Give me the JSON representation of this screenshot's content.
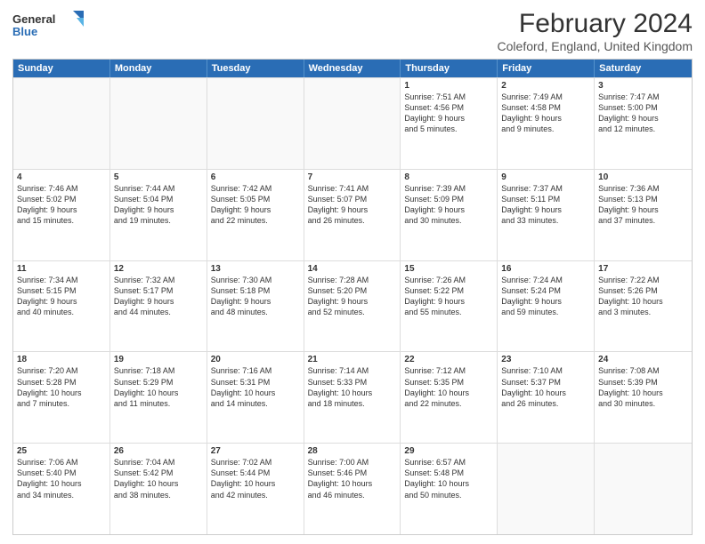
{
  "header": {
    "logo_general": "General",
    "logo_blue": "Blue",
    "title": "February 2024",
    "location": "Coleford, England, United Kingdom"
  },
  "days_of_week": [
    "Sunday",
    "Monday",
    "Tuesday",
    "Wednesday",
    "Thursday",
    "Friday",
    "Saturday"
  ],
  "weeks": [
    [
      {
        "day": "",
        "text": "",
        "empty": true
      },
      {
        "day": "",
        "text": "",
        "empty": true
      },
      {
        "day": "",
        "text": "",
        "empty": true
      },
      {
        "day": "",
        "text": "",
        "empty": true
      },
      {
        "day": "1",
        "text": "Sunrise: 7:51 AM\nSunset: 4:56 PM\nDaylight: 9 hours\nand 5 minutes.",
        "empty": false
      },
      {
        "day": "2",
        "text": "Sunrise: 7:49 AM\nSunset: 4:58 PM\nDaylight: 9 hours\nand 9 minutes.",
        "empty": false
      },
      {
        "day": "3",
        "text": "Sunrise: 7:47 AM\nSunset: 5:00 PM\nDaylight: 9 hours\nand 12 minutes.",
        "empty": false
      }
    ],
    [
      {
        "day": "4",
        "text": "Sunrise: 7:46 AM\nSunset: 5:02 PM\nDaylight: 9 hours\nand 15 minutes.",
        "empty": false
      },
      {
        "day": "5",
        "text": "Sunrise: 7:44 AM\nSunset: 5:04 PM\nDaylight: 9 hours\nand 19 minutes.",
        "empty": false
      },
      {
        "day": "6",
        "text": "Sunrise: 7:42 AM\nSunset: 5:05 PM\nDaylight: 9 hours\nand 22 minutes.",
        "empty": false
      },
      {
        "day": "7",
        "text": "Sunrise: 7:41 AM\nSunset: 5:07 PM\nDaylight: 9 hours\nand 26 minutes.",
        "empty": false
      },
      {
        "day": "8",
        "text": "Sunrise: 7:39 AM\nSunset: 5:09 PM\nDaylight: 9 hours\nand 30 minutes.",
        "empty": false
      },
      {
        "day": "9",
        "text": "Sunrise: 7:37 AM\nSunset: 5:11 PM\nDaylight: 9 hours\nand 33 minutes.",
        "empty": false
      },
      {
        "day": "10",
        "text": "Sunrise: 7:36 AM\nSunset: 5:13 PM\nDaylight: 9 hours\nand 37 minutes.",
        "empty": false
      }
    ],
    [
      {
        "day": "11",
        "text": "Sunrise: 7:34 AM\nSunset: 5:15 PM\nDaylight: 9 hours\nand 40 minutes.",
        "empty": false
      },
      {
        "day": "12",
        "text": "Sunrise: 7:32 AM\nSunset: 5:17 PM\nDaylight: 9 hours\nand 44 minutes.",
        "empty": false
      },
      {
        "day": "13",
        "text": "Sunrise: 7:30 AM\nSunset: 5:18 PM\nDaylight: 9 hours\nand 48 minutes.",
        "empty": false
      },
      {
        "day": "14",
        "text": "Sunrise: 7:28 AM\nSunset: 5:20 PM\nDaylight: 9 hours\nand 52 minutes.",
        "empty": false
      },
      {
        "day": "15",
        "text": "Sunrise: 7:26 AM\nSunset: 5:22 PM\nDaylight: 9 hours\nand 55 minutes.",
        "empty": false
      },
      {
        "day": "16",
        "text": "Sunrise: 7:24 AM\nSunset: 5:24 PM\nDaylight: 9 hours\nand 59 minutes.",
        "empty": false
      },
      {
        "day": "17",
        "text": "Sunrise: 7:22 AM\nSunset: 5:26 PM\nDaylight: 10 hours\nand 3 minutes.",
        "empty": false
      }
    ],
    [
      {
        "day": "18",
        "text": "Sunrise: 7:20 AM\nSunset: 5:28 PM\nDaylight: 10 hours\nand 7 minutes.",
        "empty": false
      },
      {
        "day": "19",
        "text": "Sunrise: 7:18 AM\nSunset: 5:29 PM\nDaylight: 10 hours\nand 11 minutes.",
        "empty": false
      },
      {
        "day": "20",
        "text": "Sunrise: 7:16 AM\nSunset: 5:31 PM\nDaylight: 10 hours\nand 14 minutes.",
        "empty": false
      },
      {
        "day": "21",
        "text": "Sunrise: 7:14 AM\nSunset: 5:33 PM\nDaylight: 10 hours\nand 18 minutes.",
        "empty": false
      },
      {
        "day": "22",
        "text": "Sunrise: 7:12 AM\nSunset: 5:35 PM\nDaylight: 10 hours\nand 22 minutes.",
        "empty": false
      },
      {
        "day": "23",
        "text": "Sunrise: 7:10 AM\nSunset: 5:37 PM\nDaylight: 10 hours\nand 26 minutes.",
        "empty": false
      },
      {
        "day": "24",
        "text": "Sunrise: 7:08 AM\nSunset: 5:39 PM\nDaylight: 10 hours\nand 30 minutes.",
        "empty": false
      }
    ],
    [
      {
        "day": "25",
        "text": "Sunrise: 7:06 AM\nSunset: 5:40 PM\nDaylight: 10 hours\nand 34 minutes.",
        "empty": false
      },
      {
        "day": "26",
        "text": "Sunrise: 7:04 AM\nSunset: 5:42 PM\nDaylight: 10 hours\nand 38 minutes.",
        "empty": false
      },
      {
        "day": "27",
        "text": "Sunrise: 7:02 AM\nSunset: 5:44 PM\nDaylight: 10 hours\nand 42 minutes.",
        "empty": false
      },
      {
        "day": "28",
        "text": "Sunrise: 7:00 AM\nSunset: 5:46 PM\nDaylight: 10 hours\nand 46 minutes.",
        "empty": false
      },
      {
        "day": "29",
        "text": "Sunrise: 6:57 AM\nSunset: 5:48 PM\nDaylight: 10 hours\nand 50 minutes.",
        "empty": false
      },
      {
        "day": "",
        "text": "",
        "empty": true
      },
      {
        "day": "",
        "text": "",
        "empty": true
      }
    ]
  ]
}
